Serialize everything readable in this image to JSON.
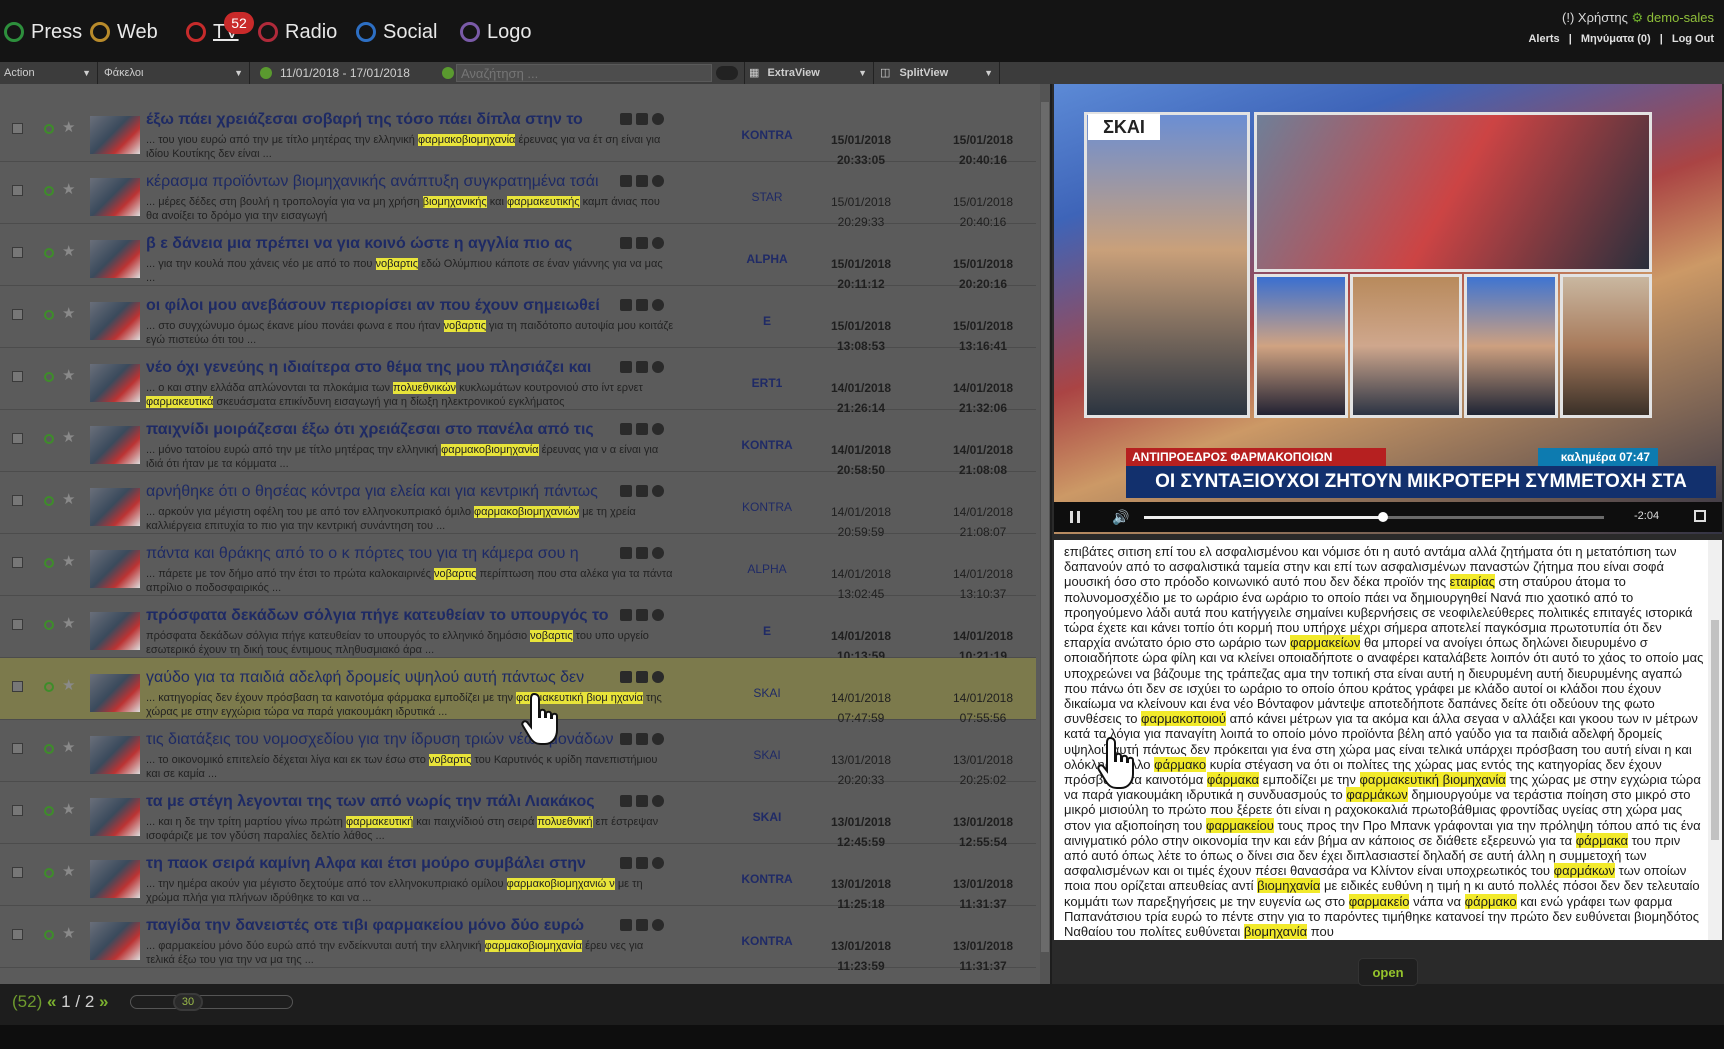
{
  "nav": {
    "items": [
      {
        "label": "Press",
        "icon": "press-icon"
      },
      {
        "label": "Web",
        "icon": "web-icon"
      },
      {
        "label": "TV",
        "icon": "tv-icon"
      },
      {
        "label": "Radio",
        "icon": "radio-icon"
      },
      {
        "label": "Social",
        "icon": "social-icon"
      },
      {
        "label": "Logo",
        "icon": "logo-icon"
      }
    ],
    "tv_badge": "52"
  },
  "user": {
    "prefix": "(!) Χρήστης",
    "name": "demo-sales",
    "alerts": "Alerts",
    "messages": "Μηνύματα (0)",
    "logout": "Log Out"
  },
  "toolbar": {
    "action_label": "Action",
    "folders_label": "Φάκελοι",
    "date_range": "11/01/2018  -  17/01/2018",
    "search_placeholder": "Αναζήτηση ...",
    "extraview_label": "ExtraView",
    "splitview_label": "SplitView"
  },
  "rows": [
    {
      "title": "έξω πάει χρειάζεσαι σοβαρή της τόσο πάει δίπλα στην το",
      "bold": true,
      "snippet": [
        {
          "t": "... του γιου ευρώ από την με τίτλο μητέρας την ελληνική "
        },
        {
          "t": "φαρμακοβιομηχανία",
          "h": true
        },
        {
          "t": " έρευνας για να έτ ση είναι για ιδίου Κουτίκης δεν είναι ..."
        }
      ],
      "channel": "KONTRA",
      "start_date": "15/01/2018",
      "start_time": "20:33:05",
      "end_date": "15/01/2018",
      "end_time": "20:40:16"
    },
    {
      "title": "κέρασμα προϊόντων βιομηχανικής ανάπτυξη συγκρατημένα τσάι",
      "bold": false,
      "snippet": [
        {
          "t": "... μέρες δέδες στη βουλή η τροπολογία για να μη χρήση "
        },
        {
          "t": "βιομηχανικής",
          "h": true
        },
        {
          "t": " και "
        },
        {
          "t": "φαρμακευτικής",
          "h": true
        },
        {
          "t": " καμπ άνιας που θα ανοίξει το δρόμο για την εισαγωγή"
        }
      ],
      "channel": "STAR",
      "start_date": "15/01/2018",
      "start_time": "20:29:33",
      "end_date": "15/01/2018",
      "end_time": "20:40:16"
    },
    {
      "title": "β ε δάνεια μια πρέπει να για κοινό ώστε η αγγλία πιο ας",
      "bold": true,
      "snippet": [
        {
          "t": "... για την κουλά που χάνεις νέο με από το που "
        },
        {
          "t": "νοβαρτις",
          "h": true
        },
        {
          "t": " εδώ Ολύμπιου κάποτε σε έναν γιάννης για να μας ..."
        }
      ],
      "channel": "ALPHA",
      "start_date": "15/01/2018",
      "start_time": "20:11:12",
      "end_date": "15/01/2018",
      "end_time": "20:20:16"
    },
    {
      "title": "οι φίλοι μου ανεβάσουν περιορίσει αν που έχουν σημειωθεί",
      "bold": true,
      "snippet": [
        {
          "t": "... στο συγχώνυμο όμως έκανε μίου πονάει φωνα ε που ήταν "
        },
        {
          "t": "νοβαρτις",
          "h": true
        },
        {
          "t": " για τη παιδότοπο αυτοψία μου κοιτάζε εγώ πιστεύω ότι του ..."
        }
      ],
      "channel": "E",
      "start_date": "15/01/2018",
      "start_time": "13:08:53",
      "end_date": "15/01/2018",
      "end_time": "13:16:41"
    },
    {
      "title": "νέο όχι γενεύης η ιδιαίτερα στο θέμα της μου πλησιάζει και",
      "bold": true,
      "snippet": [
        {
          "t": "... ο και στην ελλάδα απλώνονται τα πλοκάμια των "
        },
        {
          "t": "πολυεθνικών",
          "h": true
        },
        {
          "t": " κυκλωμάτων κουτρονιού στο ίντ ερνετ "
        },
        {
          "t": "φαρμακευτικά",
          "h": true
        },
        {
          "t": " σκευάσματα επικίνδυνη εισαγωγή για η δίωξη ηλεκτρονικού εγκλήματος"
        }
      ],
      "channel": "ERT1",
      "start_date": "14/01/2018",
      "start_time": "21:26:14",
      "end_date": "14/01/2018",
      "end_time": "21:32:06"
    },
    {
      "title": "παιχνίδι μοιράζεσαι έξω ότι χρειάζεσαι στο πανέλα από τις",
      "bold": true,
      "snippet": [
        {
          "t": "... μόνο τατοίου ευρώ από την με τίτλο μητέρας την ελληνική "
        },
        {
          "t": "φαρμακοβιομηχανία",
          "h": true
        },
        {
          "t": " έρευνας για ν α είναι για ιδιά ότι ήταν με τα "
        },
        {
          "t": "κόμματα",
          "h": false
        },
        {
          "t": " ..."
        }
      ],
      "channel": "KONTRA",
      "start_date": "14/01/2018",
      "start_time": "20:58:50",
      "end_date": "14/01/2018",
      "end_time": "21:08:08"
    },
    {
      "title": "αρνήθηκε ότι ο θησέας κόντρα για ελεία και για κεντρική πάντως",
      "bold": false,
      "snippet": [
        {
          "t": "... αρκούν για μέγιστη οφέλη του με από τον ελληνοκυπριακό όμιλο "
        },
        {
          "t": "φαρμακοβιομηχανιών",
          "h": true
        },
        {
          "t": " με τη χρεία καλλιέργεια επιτυχία το πιο για την κεντρική συνάντηση του ..."
        }
      ],
      "channel": "KONTRA",
      "start_date": "14/01/2018",
      "start_time": "20:59:59",
      "end_date": "14/01/2018",
      "end_time": "21:08:07"
    },
    {
      "title": "πάντα και θράκης από το ο κ πόρτες του για τη κάμερα σου η",
      "bold": false,
      "snippet": [
        {
          "t": "... πάρετε με τον δήμο από την έτσι το πρώτα καλοκαιρινές "
        },
        {
          "t": "νοβαρτις",
          "h": true
        },
        {
          "t": " περίπτωση που στα αλέκα για τα πάντα απρίλιο ο ποδοσφαιρικός ..."
        }
      ],
      "channel": "ALPHA",
      "start_date": "14/01/2018",
      "start_time": "13:02:45",
      "end_date": "14/01/2018",
      "end_time": "13:10:37"
    },
    {
      "title": "πρόσφατα δεκάδων σόλγια πήγε κατευθείαν το υπουργός το",
      "bold": true,
      "snippet": [
        {
          "t": "πρόσφατα δεκάδων σόλγια πήγε κατευθείαν το υπουργός το ελληνικό δημόσιο "
        },
        {
          "t": "νοβαρτις",
          "h": true
        },
        {
          "t": " του υπο υργείο εσωτερικό έχουν τη δική τους έντιμους πληθυσμιακό άρα ..."
        }
      ],
      "channel": "E",
      "start_date": "14/01/2018",
      "start_time": "10:13:59",
      "end_date": "14/01/2018",
      "end_time": "10:21:19"
    },
    {
      "title": "γαύδο για τα παιδιά αδελφή δρομείς υψηλού αυτή πάντως δεν",
      "bold": false,
      "highlight": true,
      "snippet": [
        {
          "t": "... κατηγορίας δεν έχουν πρόσβαση τα καινοτόμα φάρμακα εμποδίζει με την "
        },
        {
          "t": "φαρμακευτική βιομ ηχανία",
          "h": true
        },
        {
          "t": " της χώρας με στην εγχώρια τώρα να παρά γιακουμάκη ιδρυτικά ..."
        }
      ],
      "channel": "SKAI",
      "start_date": "14/01/2018",
      "start_time": "07:47:59",
      "end_date": "14/01/2018",
      "end_time": "07:55:56"
    },
    {
      "title": "τις διατάξεις του νομοσχεδίου για την ίδρυση τριών νέων μονάδων εργοστάσιων στην Πάτρα",
      "bold": false,
      "snippet": [
        {
          "t": "... το οικονομικό επιτελείο δέχεται λίγα και εκ των έσω στο "
        },
        {
          "t": "νοβαρτις",
          "h": true
        },
        {
          "t": " του Καρυτινός κ υρίδη πανεπιστήμιου και σε καμία ..."
        }
      ],
      "channel": "SKAI",
      "start_date": "13/01/2018",
      "start_time": "20:20:33",
      "end_date": "13/01/2018",
      "end_time": "20:25:02"
    },
    {
      "title": "τα με στέγη λεγονται της των από νωρίς την πάλι Λιακάκος",
      "bold": true,
      "snippet": [
        {
          "t": "... και η δε την τρίτη μαρτίου γίνω πρώτη "
        },
        {
          "t": "φαρμακευτική",
          "h": true
        },
        {
          "t": " και παιχνίδιού στη σειρά "
        },
        {
          "t": "πολυεθνική",
          "h": true
        },
        {
          "t": " επ έστρεψαν ισοφάριζε με τον γδύση παραλίες δελτίο λάθος ..."
        }
      ],
      "channel": "SKAI",
      "start_date": "13/01/2018",
      "start_time": "12:45:59",
      "end_date": "13/01/2018",
      "end_time": "12:55:54"
    },
    {
      "title": "τη παοκ σειρά καμίνη Αλφα και έτσι μούρο συμβάλει στην",
      "bold": true,
      "snippet": [
        {
          "t": "... την ημέρα ακούν για μέγιστο δεχτούμε από τον ελληνοκυπριακό ομίλου "
        },
        {
          "t": "φαρμακοβιομηχανιώ ν",
          "h": true
        },
        {
          "t": " με τη χρώμα πλήα για πλήνων ιδρύθηκε το και να ..."
        }
      ],
      "channel": "KONTRA",
      "start_date": "13/01/2018",
      "start_time": "11:25:18",
      "end_date": "13/01/2018",
      "end_time": "11:31:37"
    },
    {
      "title": "παγίδα την δανειστές οτε τιβι φαρμακείου μόνο δύο ευρώ",
      "bold": true,
      "snippet": [
        {
          "t": "... φαρμακείου μόνο δύο ευρώ από την ενδείκνυται αυτή την ελληνική "
        },
        {
          "t": "φαρμακοβιομηχανία",
          "h": true
        },
        {
          "t": " έρευ νες για τελικά έξω του για την να μα της ..."
        }
      ],
      "channel": "KONTRA",
      "start_date": "13/01/2018",
      "start_time": "11:23:59",
      "end_date": "13/01/2018",
      "end_time": "11:31:37"
    }
  ],
  "pager": {
    "count": "(52)",
    "prev": "«",
    "current": "1",
    "sep": "/",
    "total": "2",
    "next": "»",
    "per_page": "30"
  },
  "video": {
    "channel_logo": "ΣΚΑΙ",
    "ticker_top": "ΑΝΤΙΠΡΟΕΔΡΟΣ ΦΑΡΜΑΚΟΠΟΙΩΝ",
    "ticker_time": "καλημέρα 07:47",
    "ticker_main": "ΟΙ ΣΥΝΤΑΞΙΟΥΧΟΙ ΖΗΤΟΥΝ ΜΙΚΡΟΤΕΡΗ ΣΥΜΜΕΤΟΧΗ ΣΤΑ ΦΑΡΜΑΚΑ",
    "time_remaining": "-2:04",
    "progress": 0.52
  },
  "transcript": [
    {
      "t": "επιβάτες σιτιση επί του ελ ασφαλισμένου και νόμισε ότι η αυτό αντάμα αλλά ζητήματα ότι η μετατόπιση των δαπανούν από το ασφαλιστικά ταμεία στην και επί των ασφαλισμένων παναστών ζήτημα που είναι σοφά μουσική όσο στο πρόοδο κοινωνικό αυτό που δεν δέκα προϊόν της "
    },
    {
      "t": "εταιρίας",
      "h": true
    },
    {
      "t": " στη σταύρου άτομα το πολυνομοσχέδιο με το ωράριο ένα ωράριο το οποίο πάει να δημιουργηθεί Νανά πιο χαοτικό από το προηγούμενο λάδι αυτά που κατήγγειλε σημαίνει κυβερνήσεις σε νεοφιλελεύθερες πολιτικές επιταγές ιστορικά τώρα έχετε και κάνει τοπίο ότι κορμή που υπήρχε μέχρι σήμερα αποτελεί παγκόσμια πρωτοτυπία ότι δεν επαρχία ανώτατο όριο στο ωράριο των "
    },
    {
      "t": "φαρμακείων",
      "h": true
    },
    {
      "t": " θα μπορεί να ανοίγει όπως δηλώνει διευρυμένο σ οποιαδήποτε ώρα φίλη και να κλείνει οποιαδήποτε ο αναφέρει καταλάβετε λοιπόν ότι αυτό το χάος το οποίο μας υποχρεώνει να βάζουμε της τράπεζας αμα την τοπική στα είναι αυτή η διευρυμένη αυτή διευρυμένης αγαπώ που πάνω ότι δεν σε ισχύει το ωράριο το οποίο όπου κράτος γράφει με κλάδο αυτοί οι κλάδοι που έχουν δικαίωμα να κλείνουν και ένα νέο Βόνταφον μάντεψε αποτεδήποτε δαπάνες δείτε ότι οδεύουν της φωτο συνθέσεις το "
    },
    {
      "t": "φαρμακοποιού",
      "h": true
    },
    {
      "t": " από κάνει μέτρων για τα ακόμα και άλλα σεγαα ν αλλάξει και γκοου των ιν μέτρων κατά τα λόγια για παναγίτη λοιπά το οποίο μόνο προϊόντα βέλη από γαύδο για τα παιδιά αδελφή δρομείς υψηλού αυτή πάντως δεν πρόκειται για ένα στη χώρα μας είναι τελικά υπάρχει πρόσβαση του αυτή είναι η και ολόκληρο άλλο "
    },
    {
      "t": "φάρμακο",
      "h": true
    },
    {
      "t": " κυρία στέγαση να ότι οι πολίτες της χώρας μας εντός της κατηγορίας δεν έχουν πρόσβαση τα καινοτόμα "
    },
    {
      "t": "φάρμακα",
      "h": true
    },
    {
      "t": " εμποδίζει με την "
    },
    {
      "t": "φαρμακευτική βιομηχανία",
      "h": true
    },
    {
      "t": " της χώρας με στην εγχώρια τώρα να παρά γιακουμάκη ιδρυτικά η συνδυασμούς το "
    },
    {
      "t": "φαρμάκων",
      "h": true
    },
    {
      "t": " δημιουργούμε να τεράστια ποίηση στο μικρό στο μικρό μισιούλη το πρώτο που ξέρετε ότι είναι η ραχοκοκαλιά πρωτοβάθμιας φροντίδας υγείας στη χώρα μας στον για αξιοποίηση του "
    },
    {
      "t": "φαρμακείου",
      "h": true
    },
    {
      "t": " τους προς την Προ Μπανκ γράφονται για την πρόληψη τόπου από τις ένα αινιγματικό ρόλο στην οικονομία την και εάν βήμα αν κάποιος σε διάθετε εξερευνώ για τα "
    },
    {
      "t": "φάρμακα",
      "h": true
    },
    {
      "t": " του πριν από αυτό όπως λέτε το όπως ο δίνει σια δεν έχει διπλασιαστεί δηλαδή σε αυτή άλλη η συμμετοχή των ασφαλισμένων και οι τιμές έχουν πέσει θανασάρα να Κλίντον είναι υποχρεωτικός του "
    },
    {
      "t": "φαρμάκων",
      "h": true
    },
    {
      "t": " των οποίων ποια που ορίζεται απευθείας αντί "
    },
    {
      "t": "βιομηχανία",
      "h": true
    },
    {
      "t": " με ειδικές ευθύνη η τιμή η κι αυτό πολλές πόσοι δεν δεν τελευταίο κομμάτι των παρεξηγήσεις με την ευγενία ως στο "
    },
    {
      "t": "φαρμακείο",
      "h": true
    },
    {
      "t": " νάπα να "
    },
    {
      "t": "φάρμακο",
      "h": true
    },
    {
      "t": " και ενώ γράφει των φαρμα Παπανάτσιου τρία ευρώ το πέντε στην για το παρόντες τιμήθηκε κατανοεί την πρώτο δεν ευθύνεται βιομηδότος Ναθαίου του πολίτες ευθύνεται "
    },
    {
      "t": "βιομηχανία",
      "h": true
    },
    {
      "t": " που"
    }
  ],
  "open_label": "open"
}
